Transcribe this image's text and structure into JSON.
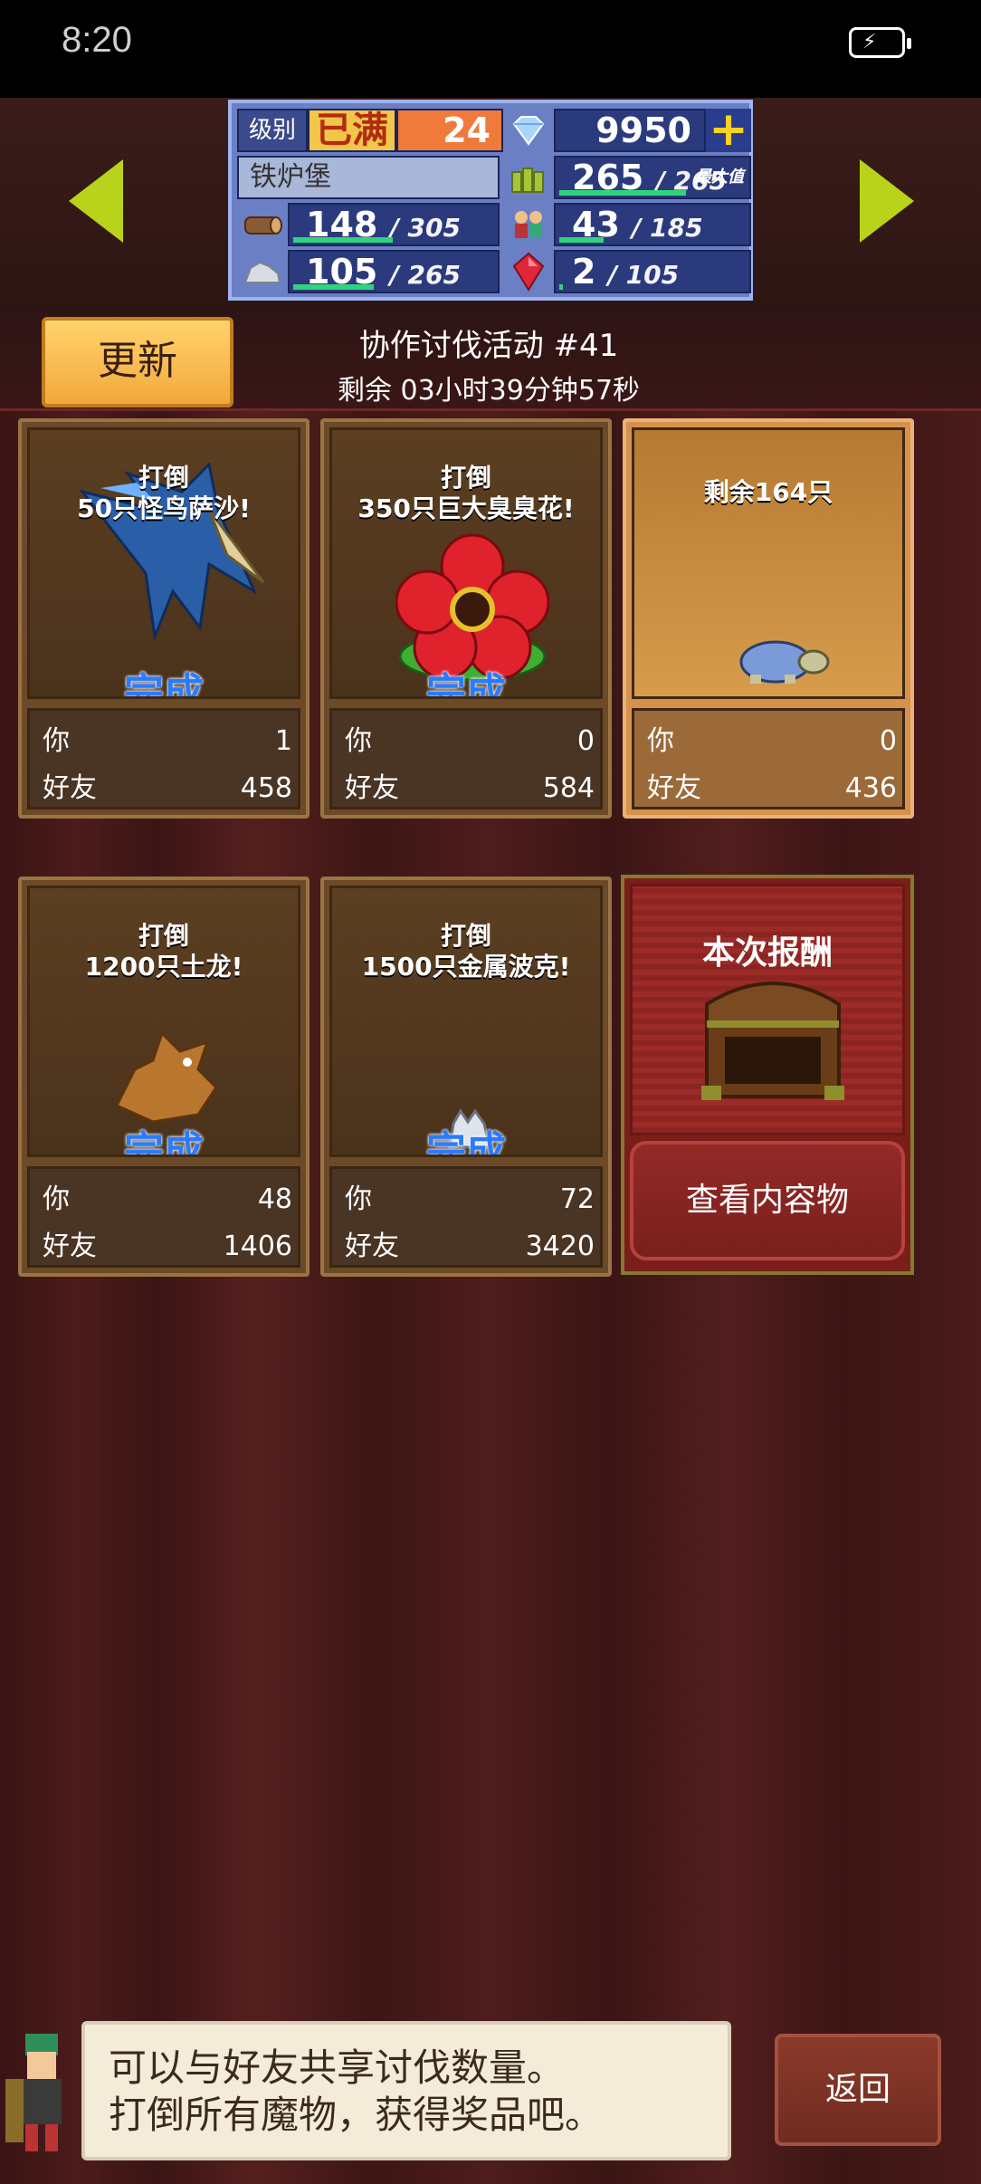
{
  "status_bar": {
    "time": "8:20"
  },
  "resources": {
    "level_label": "级别",
    "level_max": "已满",
    "level_value": "24",
    "gems": "9950",
    "castle_name": "铁炉堡",
    "food": {
      "value": "265",
      "cap": "265",
      "tag": "最大值",
      "fill": 1.0
    },
    "wood": {
      "value": "148",
      "cap": "305",
      "fill": 0.485
    },
    "citizens": {
      "value": "43",
      "cap": "185",
      "fill": 0.232
    },
    "stone": {
      "value": "105",
      "cap": "265",
      "fill": 0.396
    },
    "ruby": {
      "value": "2",
      "cap": "105",
      "fill": 0.019
    }
  },
  "event": {
    "update_label": "更新",
    "title": "协作讨伐活动 #41",
    "timer": "剩余 03小时39分钟57秒"
  },
  "cards": [
    {
      "goal1": "打倒",
      "goal2": "50只怪鸟萨沙!",
      "status": "完成",
      "you_label": "你",
      "you": "1",
      "friends_label": "好友",
      "friends": "458"
    },
    {
      "goal1": "打倒",
      "goal2": "350只巨大臭臭花!",
      "status": "完成",
      "you_label": "你",
      "you": "0",
      "friends_label": "好友",
      "friends": "584"
    },
    {
      "goal1": "剩余164只",
      "goal2": "",
      "status": "",
      "you_label": "你",
      "you": "0",
      "friends_label": "好友",
      "friends": "436"
    },
    {
      "goal1": "打倒",
      "goal2": "1200只土龙!",
      "status": "完成",
      "you_label": "你",
      "you": "48",
      "friends_label": "好友",
      "friends": "1406"
    },
    {
      "goal1": "打倒",
      "goal2": "1500只金属波克!",
      "status": "完成",
      "you_label": "你",
      "you": "72",
      "friends_label": "好友",
      "friends": "3420"
    }
  ],
  "reward": {
    "title": "本次报酬",
    "button": "查看内容物"
  },
  "dialog": {
    "line1": "可以与好友共享讨伐数量。",
    "line2": "打倒所有魔物，获得奖品吧。"
  },
  "back_label": "返回"
}
